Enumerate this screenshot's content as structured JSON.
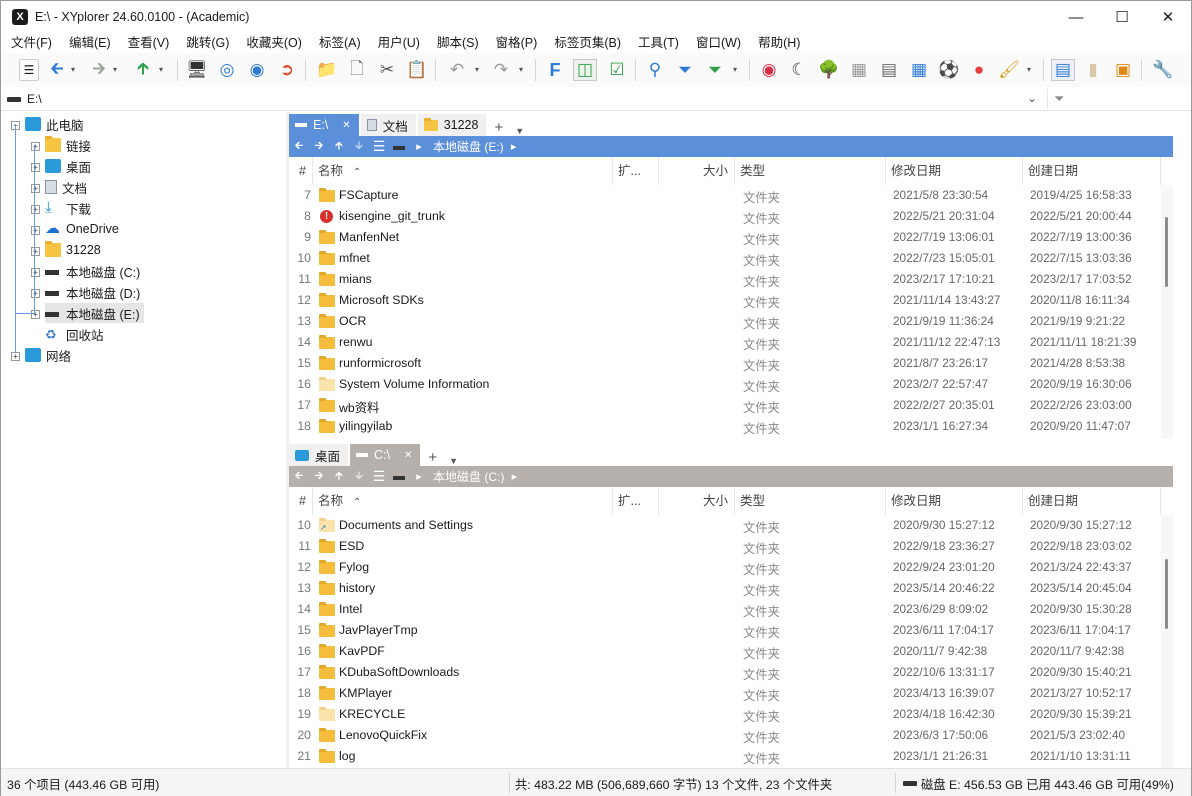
{
  "window": {
    "title": "E:\\ - XYplorer 24.60.0100 - (Academic)",
    "app_icon_text": "X"
  },
  "menu": [
    "文件(F)",
    "编辑(E)",
    "查看(V)",
    "跳转(G)",
    "收藏夹(O)",
    "标签(A)",
    "用户(U)",
    "脚本(S)",
    "窗格(P)",
    "标签页集(B)",
    "工具(T)",
    "窗口(W)",
    "帮助(H)"
  ],
  "address": {
    "value": "E:\\"
  },
  "tree": {
    "items": [
      {
        "label": "此电脑",
        "icon": "pc-icon"
      },
      {
        "label": "链接",
        "icon": "folder-icon"
      },
      {
        "label": "桌面",
        "icon": "desktop-icon"
      },
      {
        "label": "文档",
        "icon": "document-icon"
      },
      {
        "label": "下载",
        "icon": "download-icon"
      },
      {
        "label": "OneDrive",
        "icon": "cloud-icon"
      },
      {
        "label": "31228",
        "icon": "folder-icon"
      },
      {
        "label": "本地磁盘 (C:)",
        "icon": "drive-windows-icon"
      },
      {
        "label": "本地磁盘 (D:)",
        "icon": "drive-icon"
      },
      {
        "label": "本地磁盘 (E:)",
        "icon": "drive-icon"
      },
      {
        "label": "回收站",
        "icon": "recycle-bin-icon"
      },
      {
        "label": "网络",
        "icon": "network-icon"
      }
    ]
  },
  "pane1": {
    "tabs": [
      {
        "label": "E:\\",
        "active": true,
        "close": "✕"
      },
      {
        "label": "文档",
        "active": false
      },
      {
        "label": "31228",
        "active": false
      }
    ],
    "breadcrumb": "本地磁盘 (E:)",
    "accent": "#5b8fd9",
    "columns": {
      "num": "#",
      "name": "名称",
      "ext": "扩...",
      "size": "大小",
      "type": "类型",
      "modified": "修改日期",
      "created": "创建日期"
    },
    "rows": [
      {
        "num": "7",
        "name": "FSCapture",
        "type": "文件夹",
        "modified": "2021/5/8 23:30:54",
        "created": "2019/4/25 16:58:33",
        "icon": "folder"
      },
      {
        "num": "8",
        "name": "kisengine_git_trunk",
        "type": "文件夹",
        "modified": "2022/5/21 20:31:04",
        "created": "2022/5/21 20:00:44",
        "icon": "warning"
      },
      {
        "num": "9",
        "name": "ManfenNet",
        "type": "文件夹",
        "modified": "2022/7/19 13:06:01",
        "created": "2022/7/19 13:00:36",
        "icon": "folder"
      },
      {
        "num": "10",
        "name": "mfnet",
        "type": "文件夹",
        "modified": "2022/7/23 15:05:01",
        "created": "2022/7/15 13:03:36",
        "icon": "folder"
      },
      {
        "num": "11",
        "name": "mians",
        "type": "文件夹",
        "modified": "2023/2/17 17:10:21",
        "created": "2023/2/17 17:03:52",
        "icon": "folder"
      },
      {
        "num": "12",
        "name": "Microsoft SDKs",
        "type": "文件夹",
        "modified": "2021/11/14 13:43:27",
        "created": "2020/11/8 16:11:34",
        "icon": "folder"
      },
      {
        "num": "13",
        "name": "OCR",
        "type": "文件夹",
        "modified": "2021/9/19 11:36:24",
        "created": "2021/9/19 9:21:22",
        "icon": "folder"
      },
      {
        "num": "14",
        "name": "renwu",
        "type": "文件夹",
        "modified": "2021/11/12 22:47:13",
        "created": "2021/11/11 18:21:39",
        "icon": "folder"
      },
      {
        "num": "15",
        "name": "runformicrosoft",
        "type": "文件夹",
        "modified": "2021/8/7 23:26:17",
        "created": "2021/4/28 8:53:38",
        "icon": "folder"
      },
      {
        "num": "16",
        "name": "System Volume Information",
        "type": "文件夹",
        "modified": "2023/2/7 22:57:47",
        "created": "2020/9/19 16:30:06",
        "icon": "light"
      },
      {
        "num": "17",
        "name": "wb资料",
        "type": "文件夹",
        "modified": "2022/2/27 20:35:01",
        "created": "2022/2/26 23:03:00",
        "icon": "folder"
      },
      {
        "num": "18",
        "name": "yilingyilab",
        "type": "文件夹",
        "modified": "2023/1/1 16:27:34",
        "created": "2020/9/20 11:47:07",
        "icon": "folder"
      }
    ]
  },
  "pane2": {
    "tabs": [
      {
        "label": "桌面",
        "active": false
      },
      {
        "label": "C:\\",
        "active": true,
        "close": "✕"
      }
    ],
    "breadcrumb": "本地磁盘 (C:)",
    "accent": "#b5b0ab",
    "columns": {
      "num": "#",
      "name": "名称",
      "ext": "扩...",
      "size": "大小",
      "type": "类型",
      "modified": "修改日期",
      "created": "创建日期"
    },
    "rows": [
      {
        "num": "10",
        "name": "Documents and Settings",
        "type": "文件夹",
        "modified": "2020/9/30 15:27:12",
        "created": "2020/9/30 15:27:12",
        "icon": "shortcut"
      },
      {
        "num": "11",
        "name": "ESD",
        "type": "文件夹",
        "modified": "2022/9/18 23:36:27",
        "created": "2022/9/18 23:03:02",
        "icon": "folder"
      },
      {
        "num": "12",
        "name": "Fylog",
        "type": "文件夹",
        "modified": "2022/9/24 23:01:20",
        "created": "2021/3/24 22:43:37",
        "icon": "folder"
      },
      {
        "num": "13",
        "name": "history",
        "type": "文件夹",
        "modified": "2023/5/14 20:46:22",
        "created": "2023/5/14 20:45:04",
        "icon": "folder"
      },
      {
        "num": "14",
        "name": "Intel",
        "type": "文件夹",
        "modified": "2023/6/29 8:09:02",
        "created": "2020/9/30 15:30:28",
        "icon": "folder"
      },
      {
        "num": "15",
        "name": "JavPlayerTmp",
        "type": "文件夹",
        "modified": "2023/6/11 17:04:17",
        "created": "2023/6/11 17:04:17",
        "icon": "folder"
      },
      {
        "num": "16",
        "name": "KavPDF",
        "type": "文件夹",
        "modified": "2020/11/7 9:42:38",
        "created": "2020/11/7 9:42:38",
        "icon": "folder"
      },
      {
        "num": "17",
        "name": "KDubaSoftDownloads",
        "type": "文件夹",
        "modified": "2022/10/6 13:31:17",
        "created": "2020/9/30 15:40:21",
        "icon": "folder"
      },
      {
        "num": "18",
        "name": "KMPlayer",
        "type": "文件夹",
        "modified": "2023/4/13 16:39:07",
        "created": "2021/3/27 10:52:17",
        "icon": "folder"
      },
      {
        "num": "19",
        "name": "KRECYCLE",
        "type": "文件夹",
        "modified": "2023/4/18 16:42:30",
        "created": "2020/9/30 15:39:21",
        "icon": "light"
      },
      {
        "num": "20",
        "name": "LenovoQuickFix",
        "type": "文件夹",
        "modified": "2023/6/3 17:50:06",
        "created": "2021/5/3 23:02:40",
        "icon": "folder"
      },
      {
        "num": "21",
        "name": "log",
        "type": "文件夹",
        "modified": "2023/1/1 21:26:31",
        "created": "2021/1/10 13:31:11",
        "icon": "folder"
      }
    ]
  },
  "status": {
    "items": "36 个项目 (443.46 GB 可用)",
    "total": "共: 483.22 MB (506,689,660 字节)  13 个文件, 23 个文件夹",
    "disk": "磁盘 E:  456.53 GB 已用   443.46 GB 可用(49%)"
  }
}
